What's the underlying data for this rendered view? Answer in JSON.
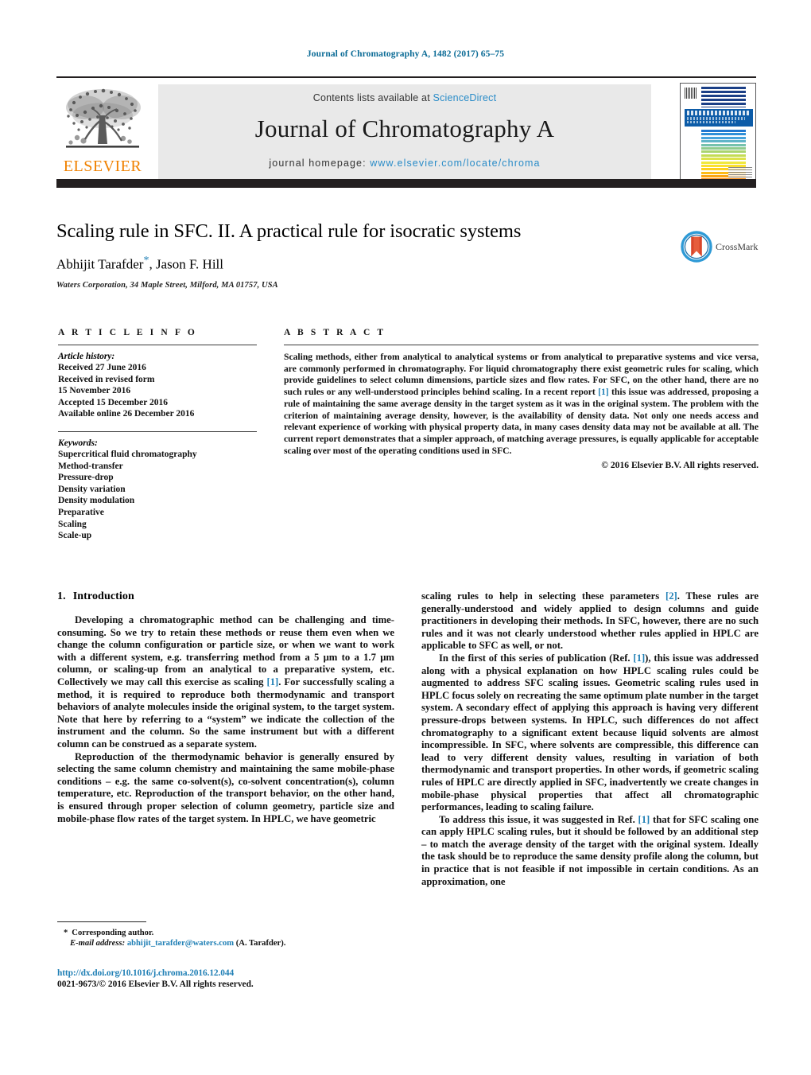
{
  "running_head": "Journal of Chromatography A, 1482 (2017) 65–75",
  "masthead": {
    "contents_prefix": "Contents lists available at ",
    "contents_link": "ScienceDirect",
    "journal_title": "Journal of Chromatography A",
    "homepage_prefix": "journal homepage: ",
    "homepage_url": "www.elsevier.com/locate/chroma",
    "publisher_wordmark": "ELSEVIER",
    "publisher_logo_icon": "elsevier-tree-icon",
    "cover_icon": "journal-cover-thumbnail",
    "cover_title_text": "JOURNAL OF CHROMATOGRAPHY A",
    "colors": {
      "link": "#2a8cc8",
      "banner_bg": "#e9e9e9",
      "rule": "#231f20",
      "elsevier_orange": "#f08100",
      "running_head": "#0b6b96"
    },
    "cover_spectrum_colors": [
      "#1f77d0",
      "#2f8fd8",
      "#46a3dd",
      "#5fb5c9",
      "#74c2ae",
      "#8ecb8f",
      "#a9d46f",
      "#c4dc55",
      "#dde34a",
      "#f0e93f",
      "#fbe02f",
      "#fdd01f",
      "#fdbb16",
      "#fca513",
      "#fa8f12",
      "#f57a12",
      "#ef6513",
      "#e85317",
      "#e0421c",
      "#d93320"
    ]
  },
  "title_block": {
    "title": "Scaling rule in SFC. II. A practical rule for isocratic systems",
    "authors": "Abhijit Tarafder",
    "corresponding_marker": "*",
    "authors_rest": ", Jason F. Hill",
    "affiliation": "Waters Corporation, 34 Maple Street, Milford, MA 01757, USA",
    "crossmark_label": "CrossMark",
    "crossmark_icon": "crossmark-logo-icon"
  },
  "article_info": {
    "heading": "A R T I C L E   I N F O",
    "history_label": "Article history:",
    "history": [
      "Received 27 June 2016",
      "Received in revised form",
      "15 November 2016",
      "Accepted 15 December 2016",
      "Available online 26 December 2016"
    ],
    "keywords_label": "Keywords:",
    "keywords": [
      "Supercritical fluid chromatography",
      "Method-transfer",
      "Pressure-drop",
      "Density variation",
      "Density modulation",
      "Preparative",
      "Scaling",
      "Scale-up"
    ]
  },
  "abstract": {
    "heading": "A B S T R A C T",
    "part1": "Scaling methods, either from analytical to analytical systems or from analytical to preparative systems and vice versa, are commonly performed in chromatography. For liquid chromatography there exist geometric rules for scaling, which provide guidelines to select column dimensions, particle sizes and flow rates. For SFC, on the other hand, there are no such rules or any well-understood principles behind scaling. In a recent report ",
    "ref1": "[1]",
    "part2": " this issue was addressed, proposing a rule of maintaining the same average density in the target system as it was in the original system. The problem with the criterion of maintaining average density, however, is the availability of density data. Not only one needs access and relevant experience of working with physical property data, in many cases density data may not be available at all. The current report demonstrates that a simpler approach, of matching average pressures, is equally applicable for acceptable scaling over most of the operating conditions used in SFC.",
    "copyright": "© 2016 Elsevier B.V. All rights reserved."
  },
  "introduction": {
    "number": "1.",
    "heading": "Introduction",
    "left_paragraphs": [
      {
        "part1": "Developing a chromatographic method can be challenging and time-consuming. So we try to retain these methods or reuse them even when we change the column configuration or particle size, or when we want to work with a different system, e.g. transferring method from a 5 μm to a 1.7 μm column, or scaling-up from an analytical to a preparative system, etc. Collectively we may call this exercise as scaling ",
        "ref": "[1]",
        "part2": ". For successfully scaling a method, it is required to reproduce both thermodynamic and transport behaviors of analyte molecules inside the original system, to the target system. Note that here by referring to a “system” we indicate the collection of the instrument and the column. So the same instrument but with a different column can be construed as a separate system."
      },
      {
        "part1": "Reproduction of the thermodynamic behavior is generally ensured by selecting the same column chemistry and maintaining the same mobile-phase conditions – e.g. the same co-solvent(s), co-solvent concentration(s), column temperature, etc. Reproduction of the transport behavior, on the other hand, is ensured through proper selection of column geometry, particle size and mobile-phase flow rates of the target system. In HPLC, we have geometric",
        "ref": "",
        "part2": ""
      }
    ],
    "right_paragraphs": [
      {
        "part1": "scaling rules to help in selecting these parameters ",
        "ref": "[2]",
        "part2": ". These rules are generally-understood and widely applied to design columns and guide practitioners in developing their methods. In SFC, however, there are no such rules and it was not clearly understood whether rules applied in HPLC are applicable to SFC as well, or not."
      },
      {
        "part1": "In the first of this series of publication (Ref. ",
        "ref": "[1]",
        "part2": "), this issue was addressed along with a physical explanation on how HPLC scaling rules could be augmented to address SFC scaling issues. Geometric scaling rules used in HPLC focus solely on recreating the same optimum plate number in the target system. A secondary effect of applying this approach is having very different pressure-drops between systems. In HPLC, such differences do not affect chromatography to a significant extent because liquid solvents are almost incompressible. In SFC, where solvents are compressible, this difference can lead to very different density values, resulting in variation of both thermodynamic and transport properties. In other words, if geometric scaling rules of HPLC are directly applied in SFC, inadvertently we create changes in mobile-phase physical properties that affect all chromatographic performances, leading to scaling failure."
      },
      {
        "part1": "To address this issue, it was suggested in Ref. ",
        "ref": "[1]",
        "part2": " that for SFC scaling one can apply HPLC scaling rules, but it should be followed by an additional step – to match the average density of the target with the original system. Ideally the task should be to reproduce the same density profile along the column, but in practice that is not feasible if not impossible in certain conditions. As an approximation, one"
      }
    ]
  },
  "footnotes": {
    "corresponding_star": "*",
    "corresponding_text": "Corresponding author.",
    "email_label": "E-mail address:",
    "email": "abhijit_tarafder@waters.com",
    "email_suffix": "(A. Tarafder)."
  },
  "imprint": {
    "doi": "http://dx.doi.org/10.1016/j.chroma.2016.12.044",
    "issn_line": "0021-9673/© 2016 Elsevier B.V. All rights reserved."
  }
}
